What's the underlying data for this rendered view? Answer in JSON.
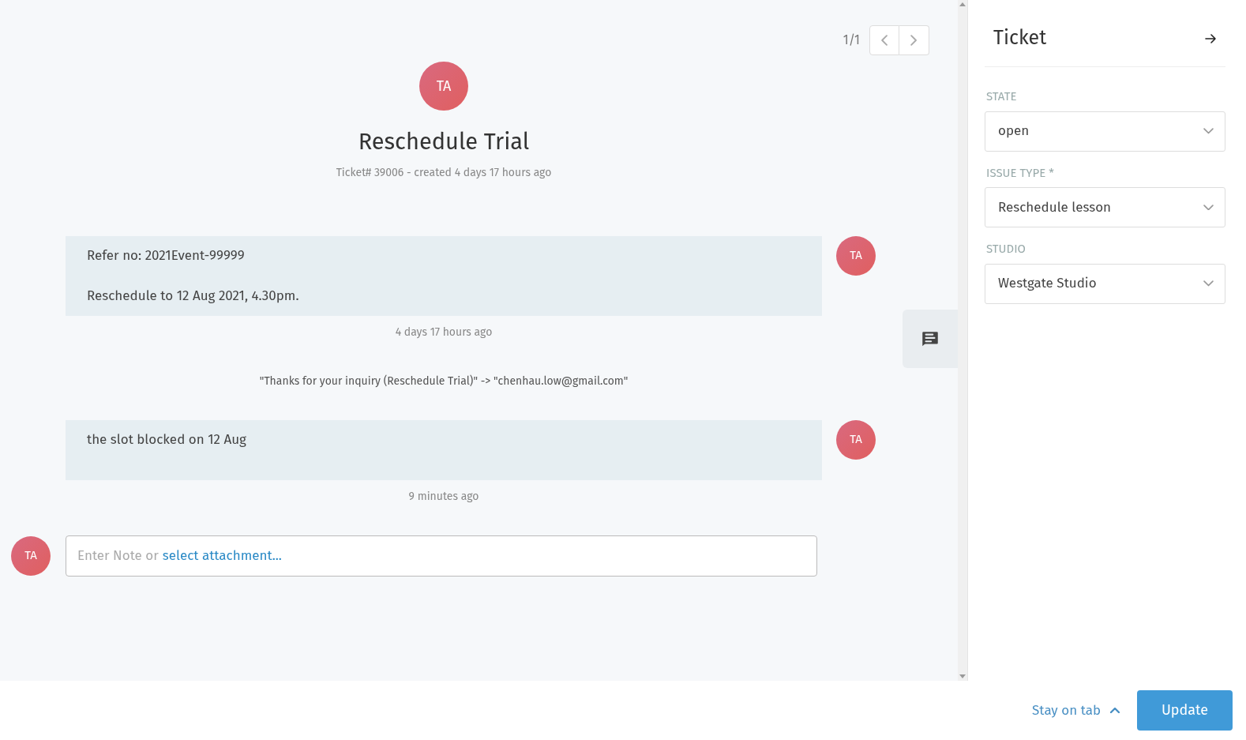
{
  "pagination": {
    "label": "1/1"
  },
  "ticket": {
    "avatar": "TA",
    "title": "Reschedule Trial",
    "meta": "Ticket# 39006 - created 4 days 17 hours ago"
  },
  "articles": [
    {
      "kind": "message",
      "lines": [
        "Refer no: 2021Event-99999",
        "Reschedule to 12 Aug 2021, 4.30pm."
      ],
      "avatar": "TA",
      "time": "4 days 17 hours ago"
    },
    {
      "kind": "system",
      "text": "\"Thanks for your inquiry (Reschedule Trial)\" -> \"chenhau.low@gmail.com\""
    },
    {
      "kind": "message",
      "lines": [
        "the slot blocked on 12 Aug"
      ],
      "avatar": "TA",
      "time": "9 minutes ago"
    }
  ],
  "composer": {
    "avatar": "TA",
    "placeholder": "Enter Note or",
    "link": "select attachment..."
  },
  "sidebar": {
    "title": "Ticket",
    "fields": [
      {
        "label": "STATE",
        "value": "open"
      },
      {
        "label": "ISSUE TYPE *",
        "value": "Reschedule lesson"
      },
      {
        "label": "STUDIO",
        "value": "Westgate Studio"
      }
    ]
  },
  "footer": {
    "stay_label": "Stay on tab",
    "button": "Update"
  }
}
